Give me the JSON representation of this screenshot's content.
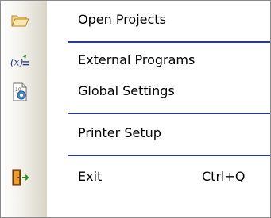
{
  "menu": {
    "items": [
      {
        "label": "Open Projects",
        "icon": "open-folder-icon"
      },
      {
        "label": "External Programs",
        "icon": "function-program-icon"
      },
      {
        "label": "Global Settings",
        "icon": "settings-document-icon"
      },
      {
        "label": "Printer Setup",
        "icon": ""
      },
      {
        "label": "Exit",
        "icon": "exit-door-icon",
        "shortcut": "Ctrl+Q"
      }
    ]
  },
  "colors": {
    "separator": "#2a3b8f",
    "gutter": "#d8d5c6",
    "border": "#8a8a8a"
  }
}
